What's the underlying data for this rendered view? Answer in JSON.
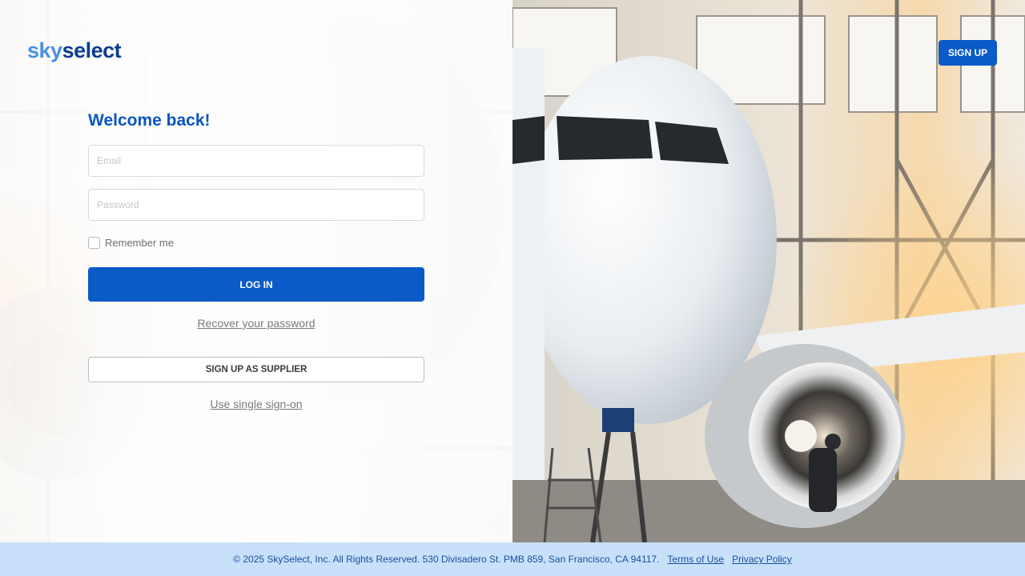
{
  "brand": {
    "logo_part1": "sky",
    "logo_part2": "select",
    "primary": "#0a5ac8",
    "secondary": "#4a90e2"
  },
  "login": {
    "heading": "Welcome back!",
    "email_placeholder": "Email",
    "password_placeholder": "Password",
    "remember_label": "Remember me",
    "login_button": "LOG IN",
    "recover_link": "Recover your password",
    "supplier_button": "SIGN UP AS SUPPLIER",
    "sso_link": "Use single sign-on"
  },
  "header": {
    "signup_button": "SIGN UP"
  },
  "footer": {
    "copyright": "© 2025 SkySelect, Inc. All Rights Reserved. 530 Divisadero St. PMB 859, San Francisco, CA 94117.",
    "terms": "Terms of Use",
    "privacy": "Privacy Policy",
    "background": "#c9e0fb"
  }
}
